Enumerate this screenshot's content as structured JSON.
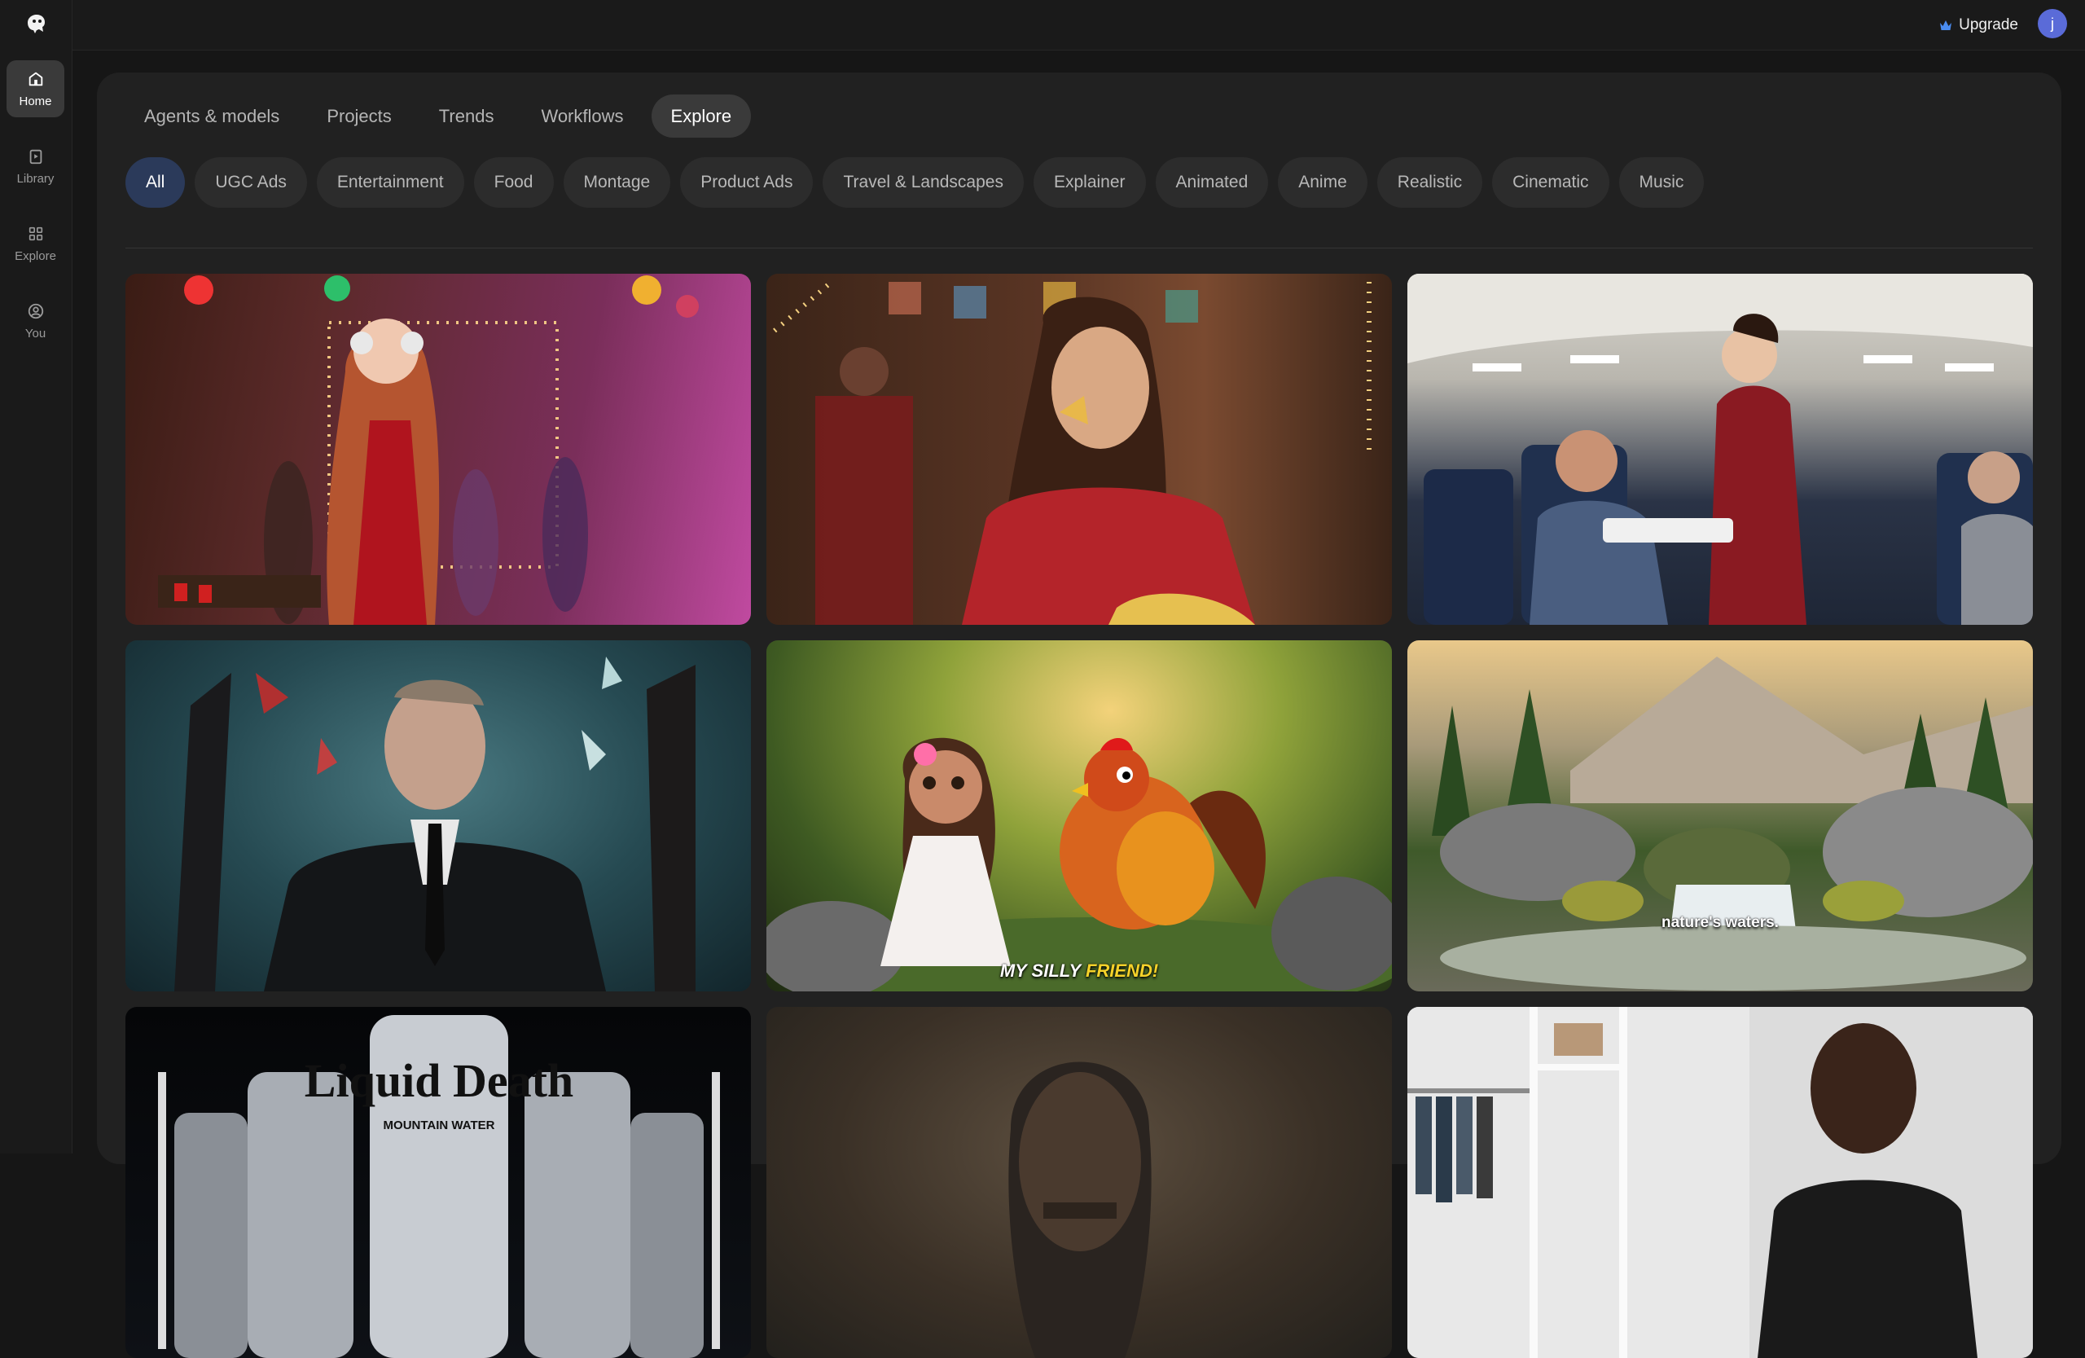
{
  "sidebar": {
    "items": [
      {
        "label": "Home",
        "icon": "home-icon"
      },
      {
        "label": "Library",
        "icon": "library-icon"
      },
      {
        "label": "Explore",
        "icon": "explore-icon"
      },
      {
        "label": "You",
        "icon": "user-icon"
      }
    ]
  },
  "topbar": {
    "upgrade_label": "Upgrade",
    "avatar_initial": "j"
  },
  "tabs": [
    "Agents & models",
    "Projects",
    "Trends",
    "Workflows",
    "Explore"
  ],
  "active_tab": "Explore",
  "categories": [
    "All",
    "UGC Ads",
    "Entertainment",
    "Food",
    "Montage",
    "Product Ads",
    "Travel & Landscapes",
    "Explainer",
    "Animated",
    "Anime",
    "Realistic",
    "Cinematic",
    "Music"
  ],
  "active_category": "All",
  "gallery": {
    "items": [
      {
        "scene": "party-girl-headphones"
      },
      {
        "scene": "woman-eating-chip"
      },
      {
        "scene": "airplane-flight-attendant"
      },
      {
        "scene": "man-in-suit-shards"
      },
      {
        "scene": "girl-and-rooster",
        "caption_a": "MY SILLY ",
        "caption_b": "FRIEND!"
      },
      {
        "scene": "mountain-waterfall",
        "caption": "nature's waters."
      },
      {
        "scene": "liquid-death-cans",
        "brand_text": "Liquid Death",
        "sub_text": "MOUNTAIN WATER"
      },
      {
        "scene": "portrait-man-sepia"
      },
      {
        "scene": "man-closet"
      }
    ]
  },
  "colors": {
    "accent": "#5a6bd8",
    "active_chip_bg": "#2b3a5a",
    "background": "#161616",
    "panel": "#212121"
  }
}
